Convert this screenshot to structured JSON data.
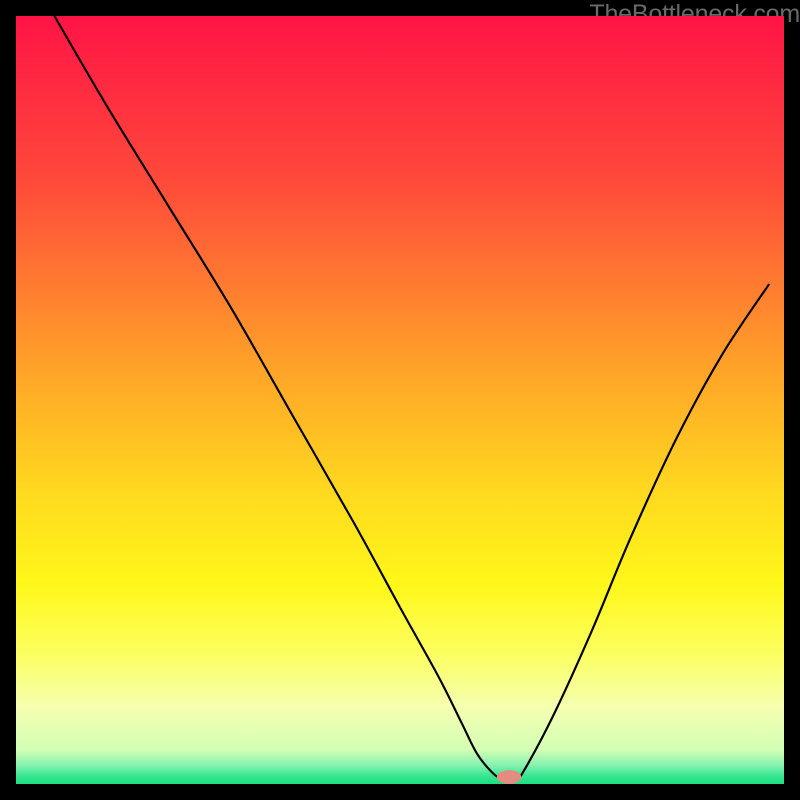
{
  "watermark": "TheBottleneck.com",
  "chart_data": {
    "type": "line",
    "title": "",
    "xlabel": "",
    "ylabel": "",
    "xlim": [
      0,
      100
    ],
    "ylim": [
      0,
      100
    ],
    "grid": false,
    "legend": false,
    "background_gradient": {
      "stops": [
        {
          "offset": 0.0,
          "color": "#ff1446"
        },
        {
          "offset": 0.22,
          "color": "#ff4b3a"
        },
        {
          "offset": 0.45,
          "color": "#ffa029"
        },
        {
          "offset": 0.62,
          "color": "#ffd91f"
        },
        {
          "offset": 0.74,
          "color": "#fff71a"
        },
        {
          "offset": 0.83,
          "color": "#fcff60"
        },
        {
          "offset": 0.9,
          "color": "#f5ffb0"
        },
        {
          "offset": 0.955,
          "color": "#d4ffb5"
        },
        {
          "offset": 0.975,
          "color": "#88f2b0"
        },
        {
          "offset": 0.99,
          "color": "#35e58f"
        },
        {
          "offset": 1.0,
          "color": "#1adf82"
        }
      ]
    },
    "series": [
      {
        "name": "bottleneck-curve",
        "x": [
          5,
          12,
          20,
          28,
          36,
          44,
          50,
          55,
          58,
          60,
          62,
          63.5,
          65,
          66,
          70,
          75,
          80,
          86,
          92,
          98
        ],
        "y": [
          100,
          88,
          75,
          62,
          48,
          34,
          23,
          14,
          8,
          4,
          1.5,
          0.5,
          0.5,
          1.5,
          9,
          20,
          32,
          45,
          56,
          65
        ]
      }
    ],
    "marker": {
      "x": 64.2,
      "y": 0.9,
      "color": "#e58b82",
      "rx": 1.6,
      "ry": 0.9
    }
  }
}
